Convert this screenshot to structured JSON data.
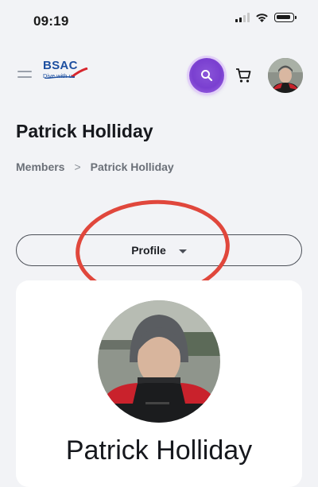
{
  "status_bar": {
    "time": "09:19"
  },
  "header": {
    "logo": {
      "text": "BSAC",
      "tagline": "Dive with us"
    },
    "search_icon": "search-icon",
    "cart_icon": "cart-icon"
  },
  "page": {
    "title": "Patrick Holliday",
    "breadcrumb": {
      "parent": "Members",
      "separator": ">",
      "current": "Patrick Holliday"
    }
  },
  "dropdown": {
    "selected": "Profile"
  },
  "profile": {
    "name": "Patrick Holliday"
  },
  "colors": {
    "accent": "#7a3fd0",
    "annotation": "#e0473c",
    "brand": "#1d4fa0"
  }
}
